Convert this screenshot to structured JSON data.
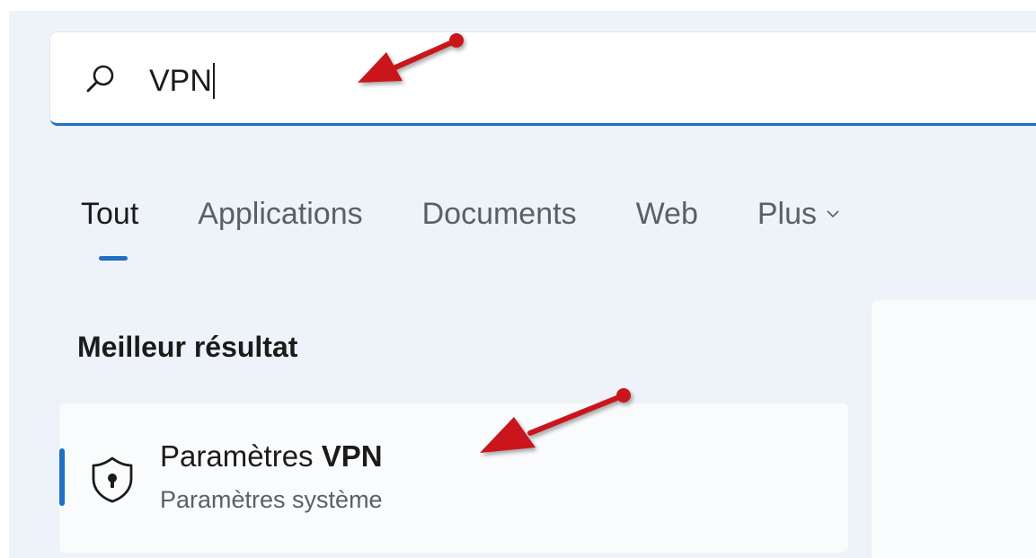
{
  "search": {
    "query": "VPN"
  },
  "tabs": [
    {
      "label": "Tout",
      "active": true
    },
    {
      "label": "Applications",
      "active": false
    },
    {
      "label": "Documents",
      "active": false
    },
    {
      "label": "Web",
      "active": false
    },
    {
      "label": "Plus",
      "active": false
    }
  ],
  "best_match": {
    "heading": "Meilleur résultat",
    "title_prefix": "Paramètres ",
    "title_bold": "VPN",
    "subtitle": "Paramètres système",
    "icon": "shield-lock-icon"
  },
  "colors": {
    "accent": "#1f6fc4",
    "annotation_arrow": "#c8141a",
    "panel_background": "#eef3f9"
  }
}
